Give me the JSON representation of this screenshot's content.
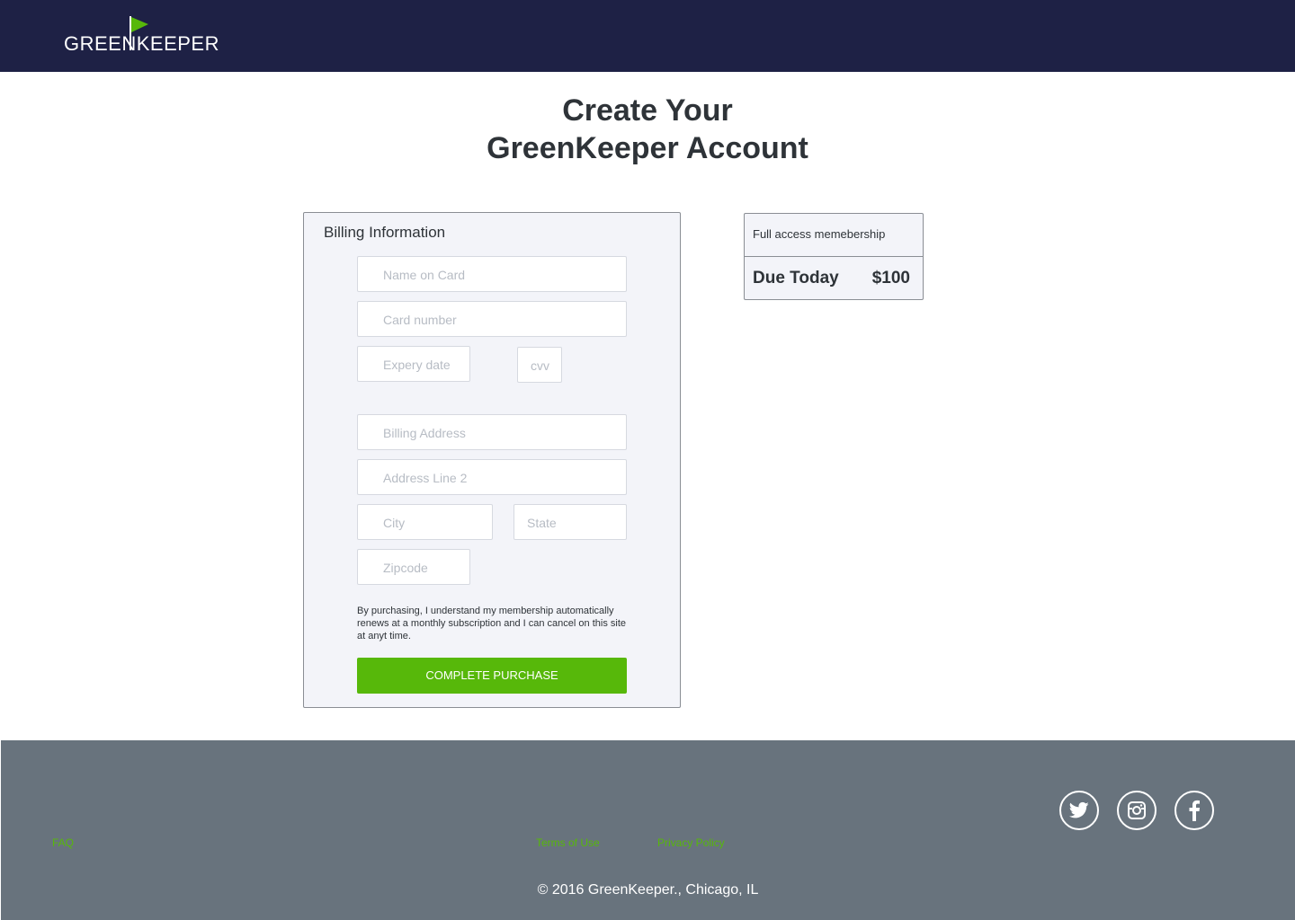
{
  "header": {
    "logo_text": "GREENKEEPER",
    "brand_color": "#1e2145",
    "accent_color": "#57b80a"
  },
  "page": {
    "title_line1": "Create Your",
    "title_line2": "GreenKeeper Account"
  },
  "billing": {
    "heading": "Billing Information",
    "fields": {
      "name_on_card": "Name on Card",
      "card_number": "Card number",
      "expiry_date": "Expery date",
      "cvv": "cvv",
      "billing_address": "Billing Address",
      "address_line_2": "Address Line 2",
      "city": "City",
      "state": "State",
      "zipcode": "Zipcode"
    },
    "disclaimer": "By purchasing, I understand my membership automatically renews at a monthly subscription and I can cancel on this site at anyt time.",
    "submit_label": "COMPLETE PURCHASE"
  },
  "summary": {
    "plan_label": "Full access memebership",
    "due_label": "Due Today",
    "due_amount": "$100"
  },
  "footer": {
    "faq": "FAQ",
    "terms": "Terms of Use",
    "privacy": "Privacy Policy",
    "copyright": "© 2016 GreenKeeper., Chicago, IL",
    "social": [
      "twitter-icon",
      "instagram-icon",
      "facebook-icon"
    ]
  }
}
